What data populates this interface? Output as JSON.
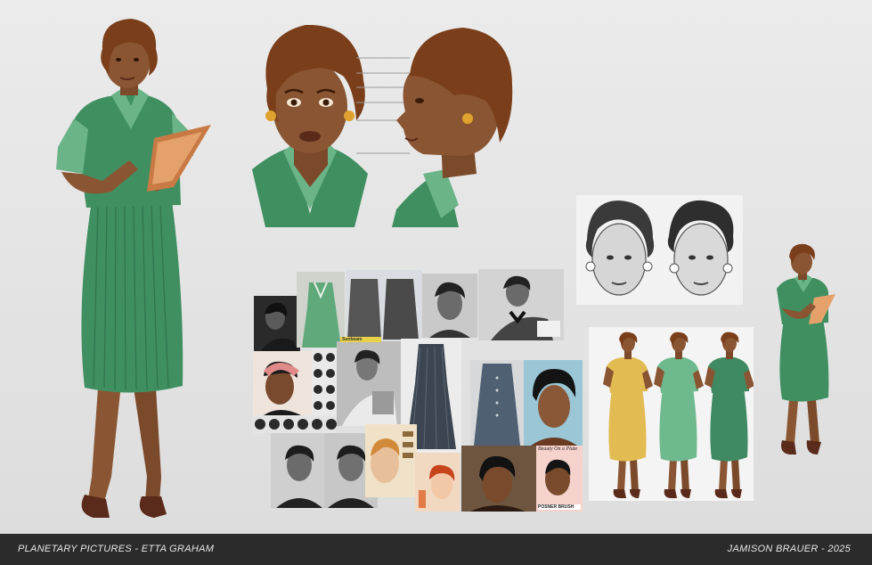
{
  "footer": {
    "left": "PLANETARY PICTURES - ETTA GRAHAM",
    "right": "JAMISON BRAUER - 2025"
  },
  "character": {
    "skin": "#8a5532",
    "hair": "#7a3e1a",
    "dress": "#3f8f61",
    "dress_dark": "#2c6b47",
    "collar": "#6bb488",
    "shoes": "#5a2a1a"
  },
  "reference_labels": {
    "magazine_top": "Beauty On a Plate",
    "magazine_bottom": "POSNER BRUSH",
    "price_tag": "Sunbeam"
  },
  "colorways": [
    "#e2bb52",
    "#6fb98e",
    "#3f8a62"
  ]
}
